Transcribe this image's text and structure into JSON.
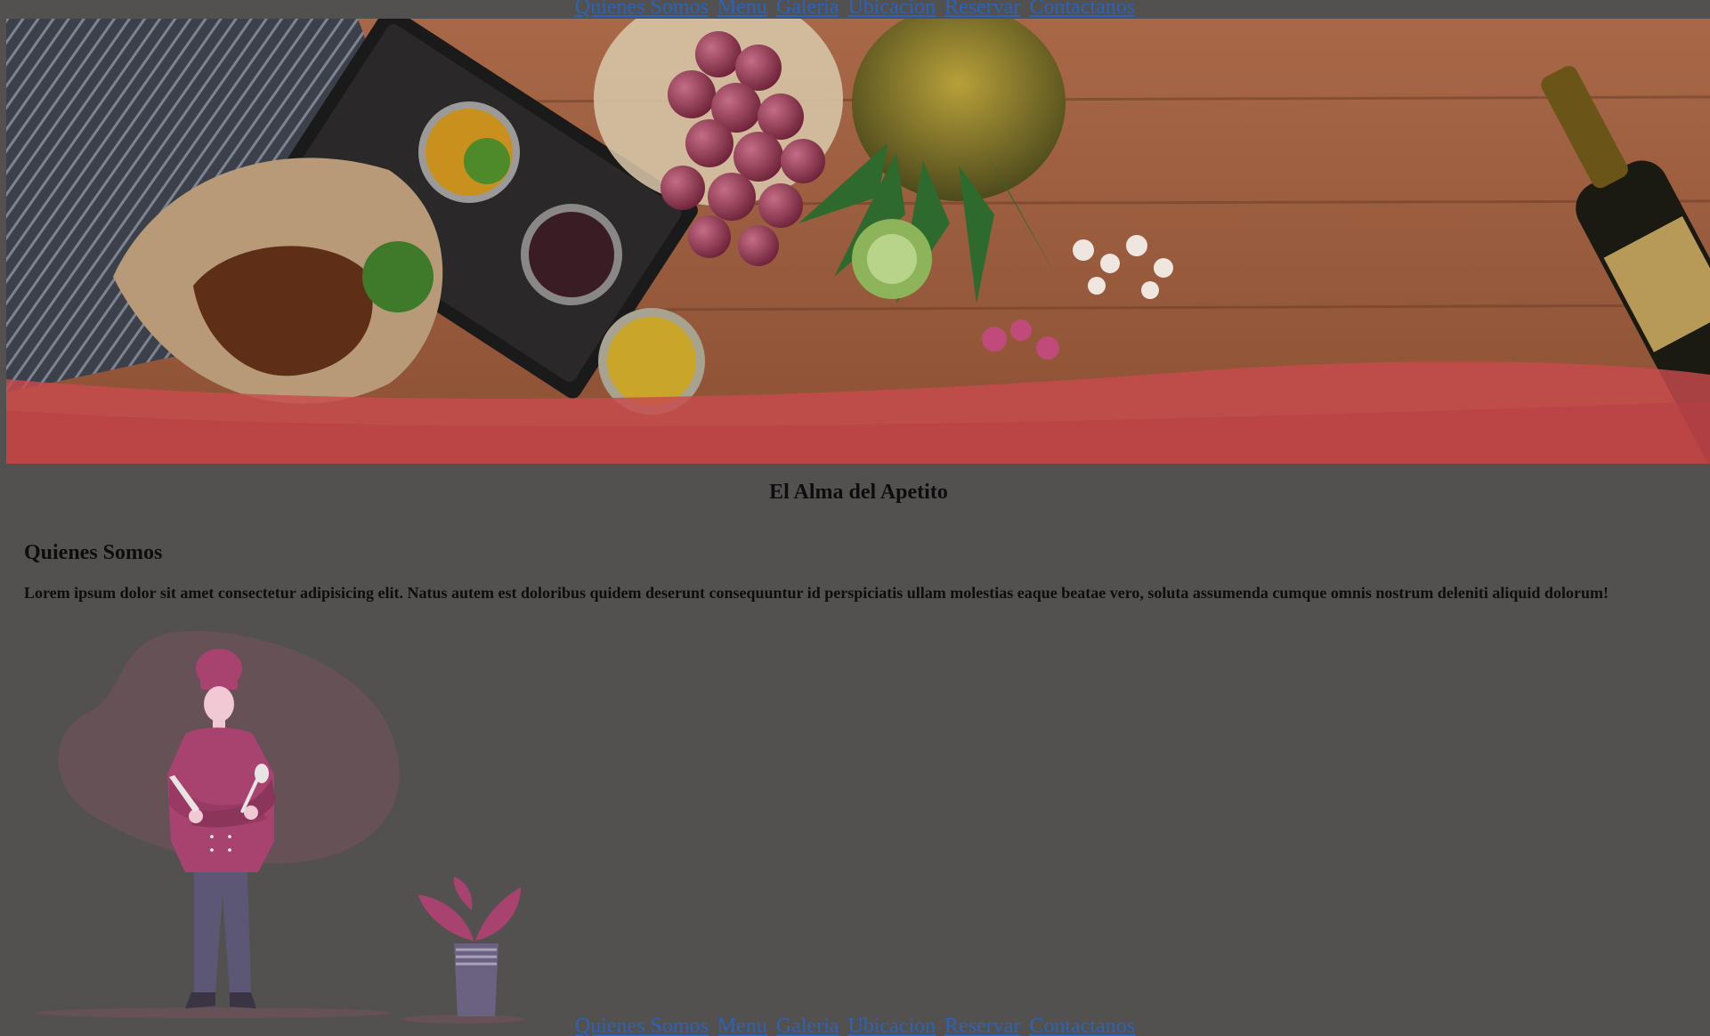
{
  "nav": {
    "items": [
      {
        "label": "Quienes Somos"
      },
      {
        "label": "Menu"
      },
      {
        "label": "Galeria"
      },
      {
        "label": "Ubicacion"
      },
      {
        "label": "Reservar"
      },
      {
        "label": "Contactanos"
      }
    ]
  },
  "hero": {
    "band_color": "#c84a4d"
  },
  "tagline": "El Alma del Apetito",
  "about": {
    "title": "Quienes Somos",
    "text": "Lorem ipsum dolor sit amet consectetur adipisicing elit. Natus autem est doloribus quidem deserunt consequuntur id perspiciatis ullam molestias eaque beatae vero, soluta assumenda cumque omnis nostrum deleniti aliquid dolorum!"
  },
  "colors": {
    "page_background": "#535050",
    "link": "#2b63b8",
    "chef_accent": "#a8436f",
    "chef_trousers": "#5b5775"
  }
}
